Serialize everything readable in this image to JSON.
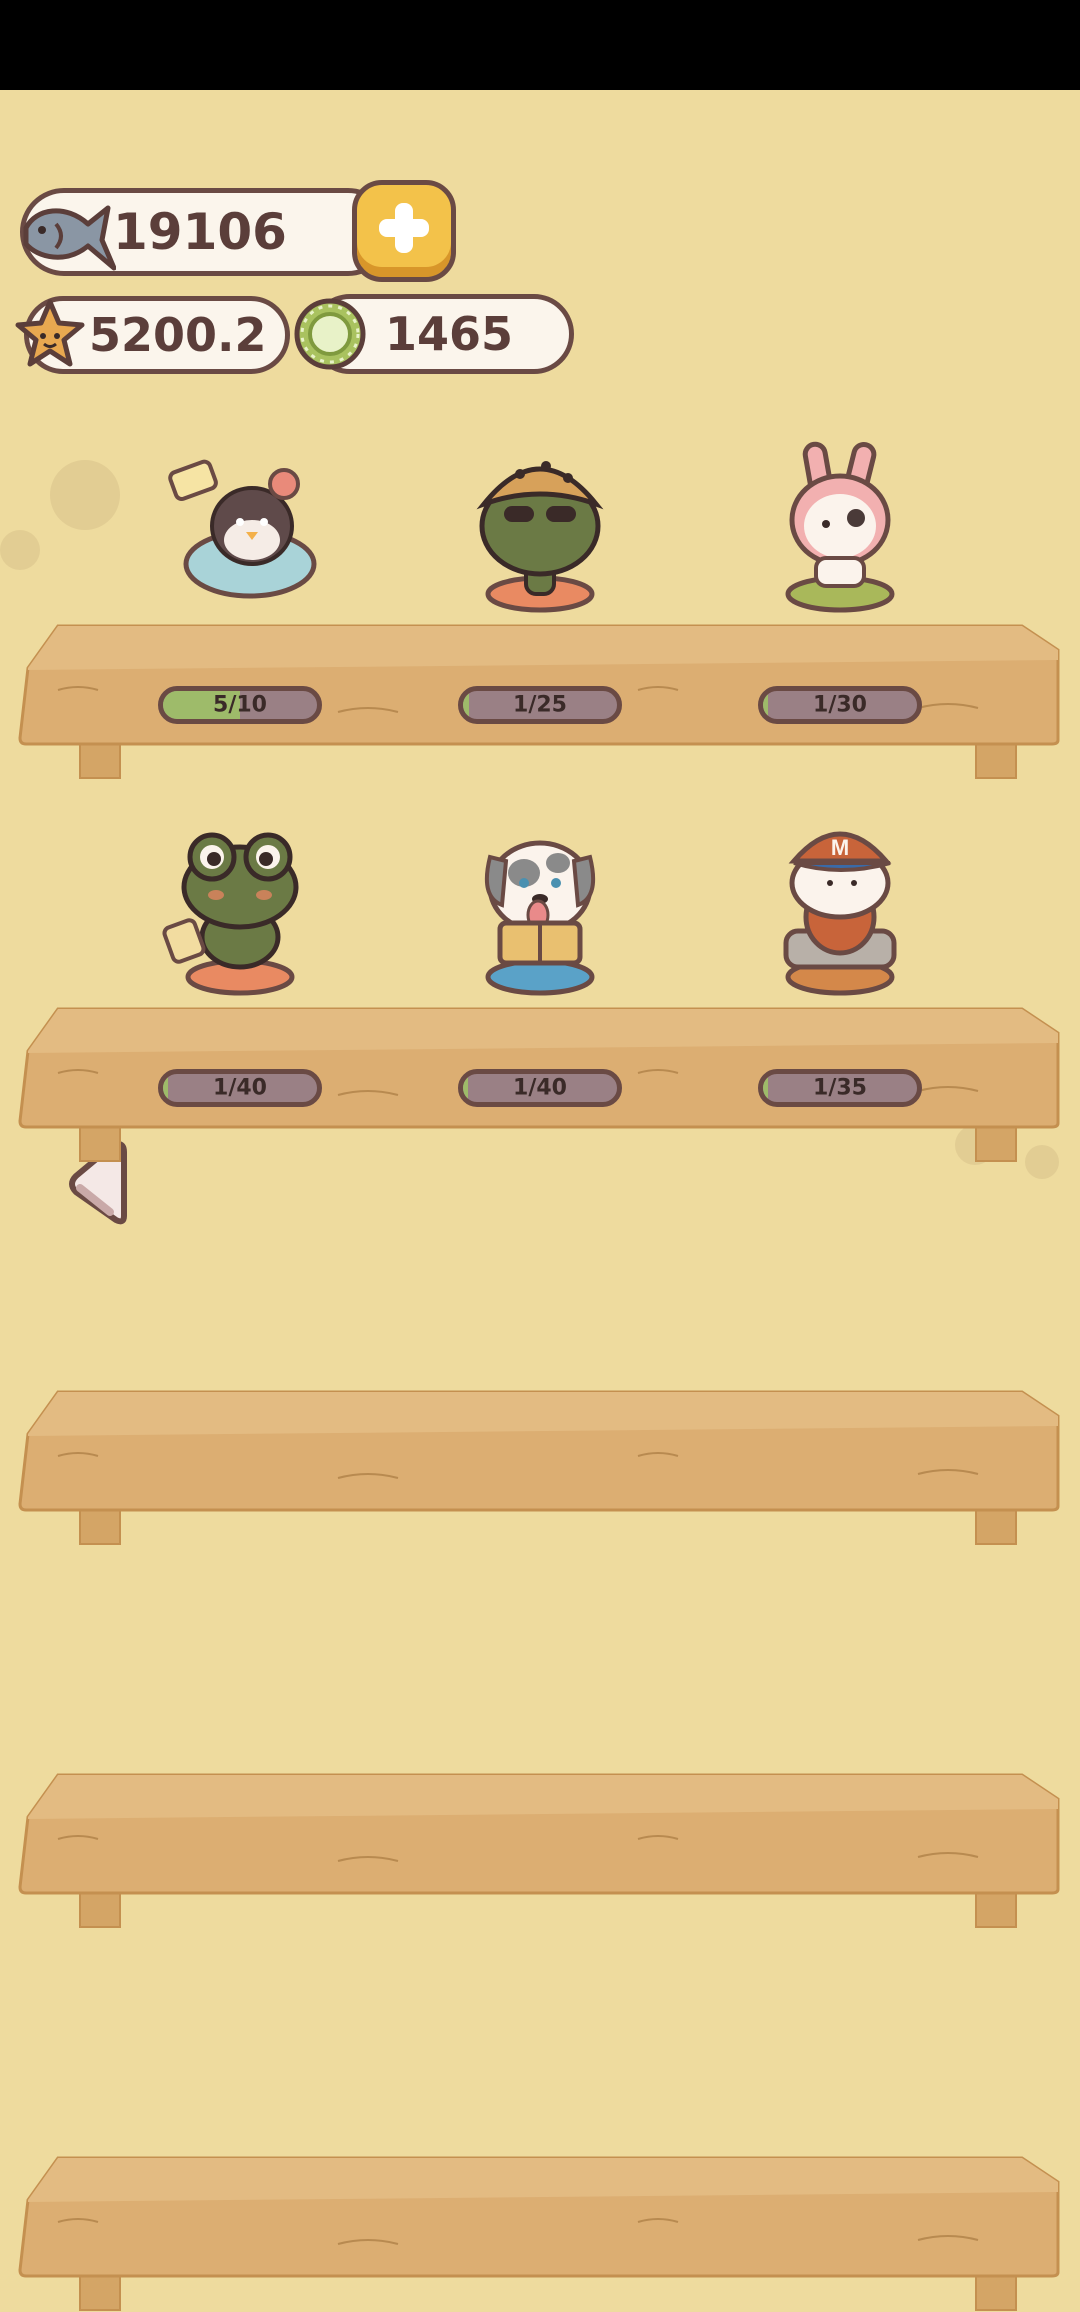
{
  "currency": {
    "fish": "19106",
    "star": "5200.2",
    "coin": "1465"
  },
  "icons": {
    "fish": "fish-icon",
    "star": "star-icon",
    "coin": "green-coin-icon",
    "add": "plus-icon",
    "back": "back-arrow-icon"
  },
  "shelves": [
    {
      "items": [
        {
          "name": "penguin-figure",
          "progress": "5/10",
          "fraction": 0.5
        },
        {
          "name": "leopard-hat-frog-figure",
          "progress": "1/25",
          "fraction": 0.04
        },
        {
          "name": "bunny-hood-figure",
          "progress": "1/30",
          "fraction": 0.033
        }
      ]
    },
    {
      "items": [
        {
          "name": "frog-figure",
          "progress": "1/40",
          "fraction": 0.025
        },
        {
          "name": "dog-reading-figure",
          "progress": "1/40",
          "fraction": 0.025
        },
        {
          "name": "corgi-cap-figure",
          "progress": "1/35",
          "fraction": 0.029
        }
      ]
    },
    {
      "items": []
    },
    {
      "items": []
    },
    {
      "items": []
    }
  ],
  "colors": {
    "background": "#eedb9e",
    "shelf": "#dcae72",
    "progress_fill": "#9ebb6a",
    "progress_track": "#9a8085"
  }
}
